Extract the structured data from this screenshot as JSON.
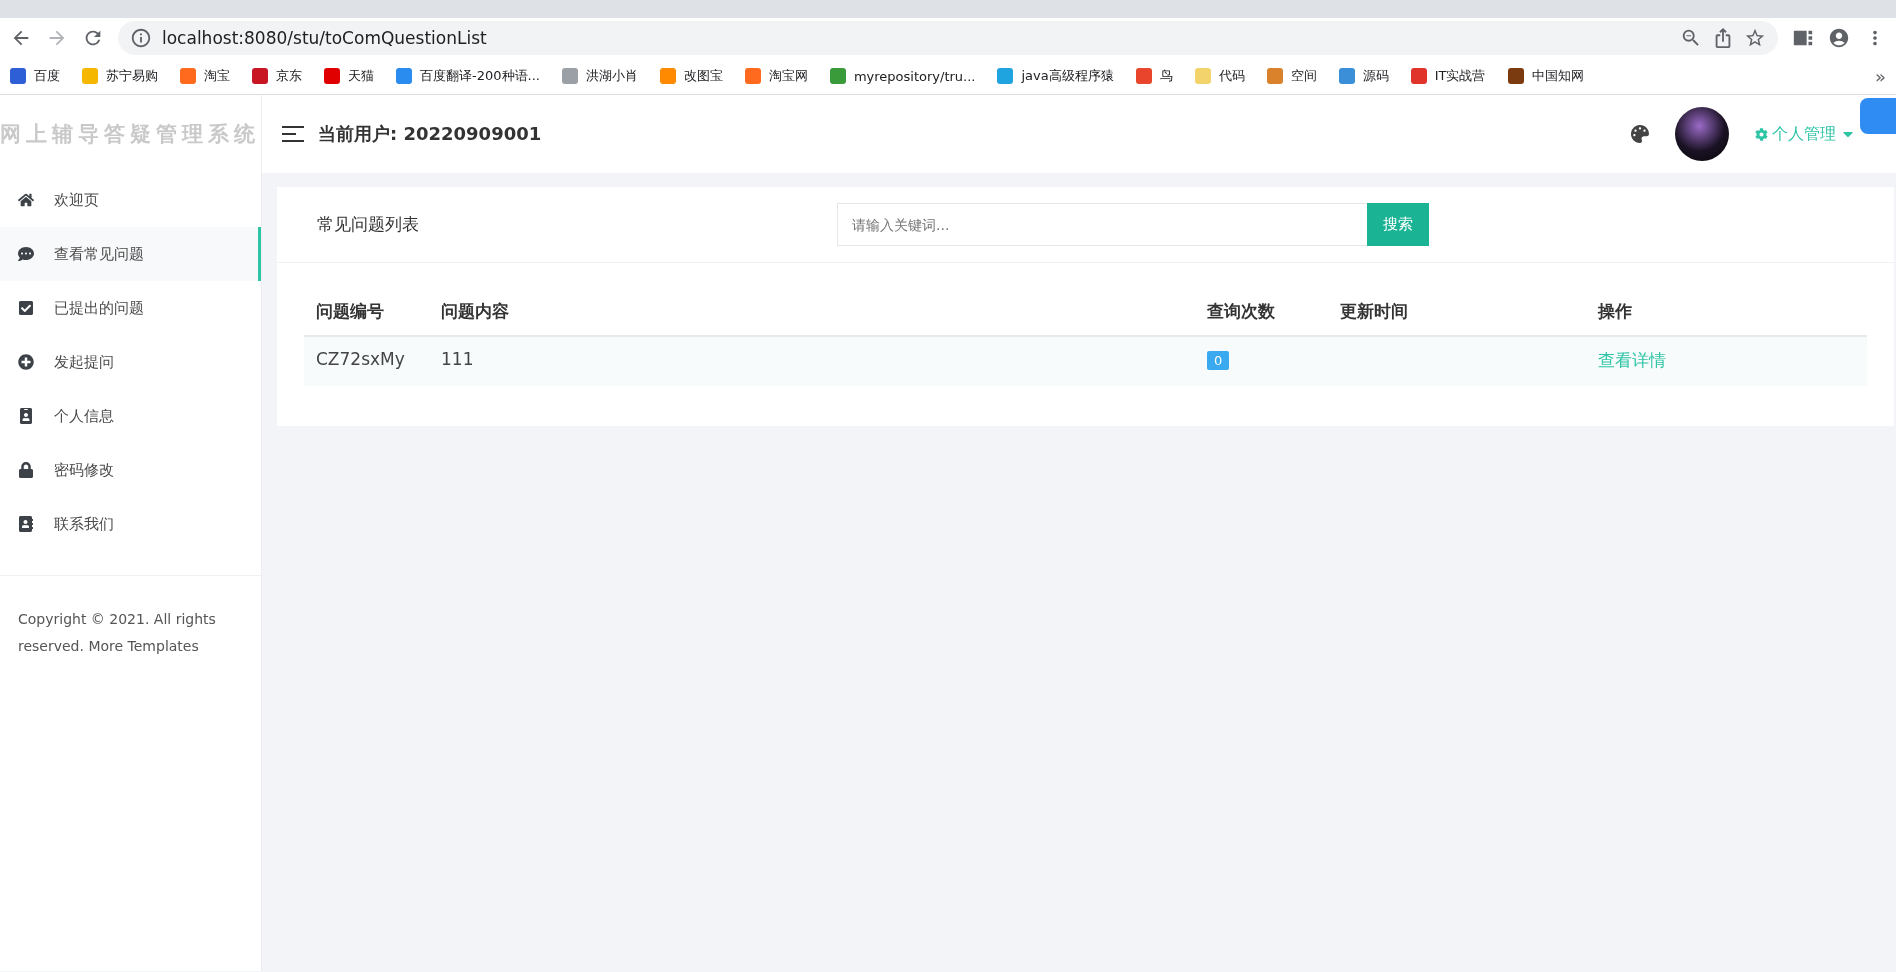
{
  "browser": {
    "url": "localhost:8080/stu/toComQuestionList",
    "bookmarks": [
      {
        "label": "百度",
        "color": "#2f5fd6"
      },
      {
        "label": "苏宁易购",
        "color": "#f5b700"
      },
      {
        "label": "淘宝",
        "color": "#ff6a1f"
      },
      {
        "label": "京东",
        "color": "#c91623"
      },
      {
        "label": "天猫",
        "color": "#e00000"
      },
      {
        "label": "百度翻译-200种语...",
        "color": "#2b8cf0"
      },
      {
        "label": "洪湖小肖",
        "color": "#9aa0a6"
      },
      {
        "label": "改图宝",
        "color": "#ff8a00"
      },
      {
        "label": "淘宝网",
        "color": "#ff6a1f"
      },
      {
        "label": "myrepository/tru...",
        "color": "#3a9b3a"
      },
      {
        "label": "java高级程序猿",
        "color": "#20a4e0"
      },
      {
        "label": "鸟",
        "color": "#e8452c"
      },
      {
        "label": "代码",
        "color": "#f3d36b"
      },
      {
        "label": "空间",
        "color": "#d9822b"
      },
      {
        "label": "源码",
        "color": "#3b8ed8"
      },
      {
        "label": "IT实战营",
        "color": "#e0342a"
      },
      {
        "label": "中国知网",
        "color": "#7a3b10"
      }
    ],
    "more": "»"
  },
  "sidebar": {
    "logo": "网上辅导答疑管理系统",
    "items": [
      {
        "label": "欢迎页",
        "kind": "home",
        "selected": false
      },
      {
        "label": "查看常见问题",
        "kind": "chat",
        "selected": true
      },
      {
        "label": "已提出的问题",
        "kind": "check",
        "selected": false
      },
      {
        "label": "发起提问",
        "kind": "plus",
        "selected": false
      },
      {
        "label": "个人信息",
        "kind": "badge",
        "selected": false
      },
      {
        "label": "密码修改",
        "kind": "lock",
        "selected": false
      },
      {
        "label": "联系我们",
        "kind": "contact",
        "selected": false
      }
    ],
    "footer": "Copyright © 2021. All rights reserved. More Templates"
  },
  "header": {
    "user": "当前用户: 20220909001",
    "menu": "个人管理"
  },
  "panel": {
    "title": "常见问题列表",
    "search": {
      "placeholder": "请输入关键词..."
    },
    "search_button": "搜索",
    "table": {
      "columns": [
        "问题编号",
        "问题内容",
        "查询次数",
        "更新时间",
        "操作"
      ],
      "rows": [
        {
          "id": "CZ72sxMy",
          "content": "111",
          "count": "0",
          "updated": "",
          "action": "查看详情"
        }
      ]
    }
  }
}
